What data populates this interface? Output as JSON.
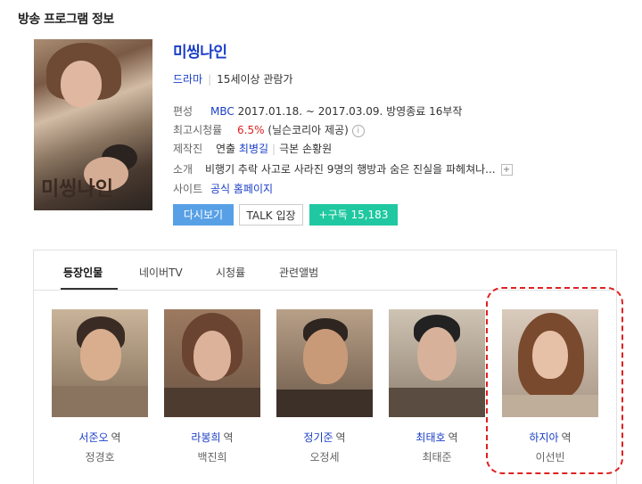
{
  "section_title": "방송 프로그램 정보",
  "program": {
    "title": "미씽나인",
    "genre": "드라마",
    "rating": "15세이상 관람가",
    "schedule_label": "편성",
    "broadcaster": "MBC",
    "schedule": "2017.01.18. ~ 2017.03.09. 방영종료 16부작",
    "peak_label": "최고시청률",
    "peak_value": "6.5%",
    "peak_source": "(닐슨코리아 제공)",
    "production_label": "제작진",
    "director_role": "연출",
    "director": "최병길",
    "writer": "극본 손황원",
    "intro_label": "소개",
    "intro": "비행기 추락 사고로 사라진 9명의 행방과 숨은 진실을 파헤쳐나...",
    "site_label": "사이트",
    "site_link": "공식 홈페이지"
  },
  "buttons": {
    "watch": "다시보기",
    "talk": "TALK 입장",
    "subscribe": "+구독 15,183"
  },
  "tabs": [
    "등장인물",
    "네이버TV",
    "시청률",
    "관련앨범"
  ],
  "cast": [
    {
      "role": "서준오",
      "suffix": "역",
      "actor": "정경호"
    },
    {
      "role": "라봉희",
      "suffix": "역",
      "actor": "백진희"
    },
    {
      "role": "정기준",
      "suffix": "역",
      "actor": "오정세"
    },
    {
      "role": "최태호",
      "suffix": "역",
      "actor": "최태준"
    },
    {
      "role": "하지아",
      "suffix": "역",
      "actor": "이선빈"
    }
  ],
  "poster_logo": "미씽나인",
  "icons": {
    "info": "info-icon",
    "expand": "plus-icon"
  },
  "colors": {
    "link": "#1a3ec7",
    "accent_blue": "#58a0e6",
    "accent_green": "#1fc8a0",
    "highlight": "#e02020"
  }
}
